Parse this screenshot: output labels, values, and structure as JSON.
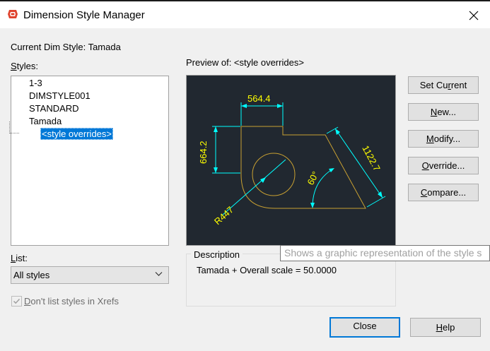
{
  "window": {
    "title": "Dimension Style Manager",
    "app_icon": "autocad-logo-icon",
    "close_icon": "close-icon"
  },
  "current": {
    "label": "Current Dim Style:",
    "value": "Tamada",
    "text": "Current Dim Style: Tamada"
  },
  "styles": {
    "label": "Styles:",
    "items": [
      "1-3",
      "DIMSTYLE001",
      "STANDARD",
      "Tamada"
    ],
    "selected_child": "<style overrides>"
  },
  "preview": {
    "label": "Preview of: <style overrides>",
    "background": "#212830",
    "geometry_color": "#c8a032",
    "dim_color": "#00ffff",
    "text_color": "#ffff00",
    "dims": {
      "width": "564.4",
      "height": "664.2",
      "diagonal": "1122.7",
      "angle": "60°",
      "radius": "R447"
    }
  },
  "buttons": {
    "set_current": "Set Current",
    "new": "New...",
    "modify": "Modify...",
    "override": "Override...",
    "compare": "Compare...",
    "close": "Close",
    "help": "Help"
  },
  "description": {
    "title": "Description",
    "text": "Tamada + Overall scale = 50.0000"
  },
  "tooltip": {
    "text": "Shows a graphic representation of the style s"
  },
  "list": {
    "label": "List:",
    "selected": "All styles"
  },
  "xrefs": {
    "label": "Don't list styles in Xrefs",
    "checked": true,
    "disabled": true
  },
  "colors": {
    "accent": "#0078d7",
    "selection": "#0078d7"
  }
}
